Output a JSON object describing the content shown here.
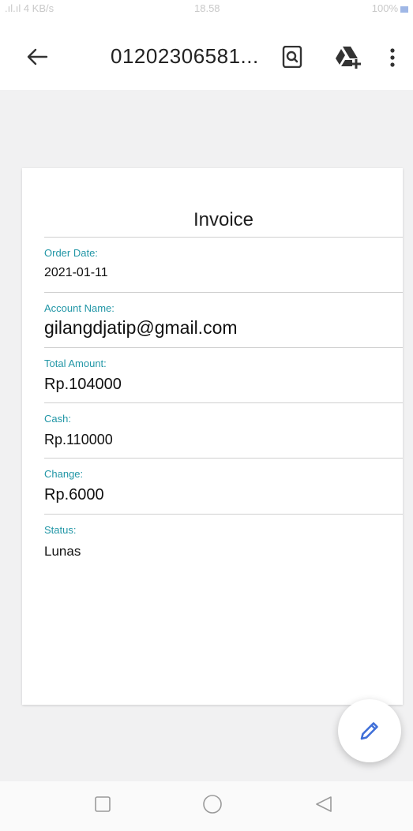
{
  "status_bar": {
    "left": ".ıl.ıl 4 KB/s",
    "time": "18.58",
    "right": "100%"
  },
  "app_bar": {
    "title": "01202306581..."
  },
  "invoice": {
    "title": "Invoice",
    "fields": [
      {
        "label": "Order Date:",
        "value": "2021-01-11"
      },
      {
        "label": "Account Name:",
        "value": "gilangdjatip@gmail.com"
      },
      {
        "label": "Total Amount:",
        "value": "Rp.104000"
      },
      {
        "label": "Cash:",
        "value": "Rp.110000"
      },
      {
        "label": "Change:",
        "value": "Rp.6000"
      },
      {
        "label": "Status:",
        "value": "Lunas"
      }
    ]
  },
  "colors": {
    "label_accent": "#2196a6",
    "fab_icon": "#3f6fd8"
  },
  "icons": [
    "back-arrow-icon",
    "document-search-icon",
    "drive-add-icon",
    "more-vert-icon",
    "edit-pencil-icon",
    "recent-apps-icon",
    "home-circle-icon",
    "back-triangle-icon"
  ]
}
